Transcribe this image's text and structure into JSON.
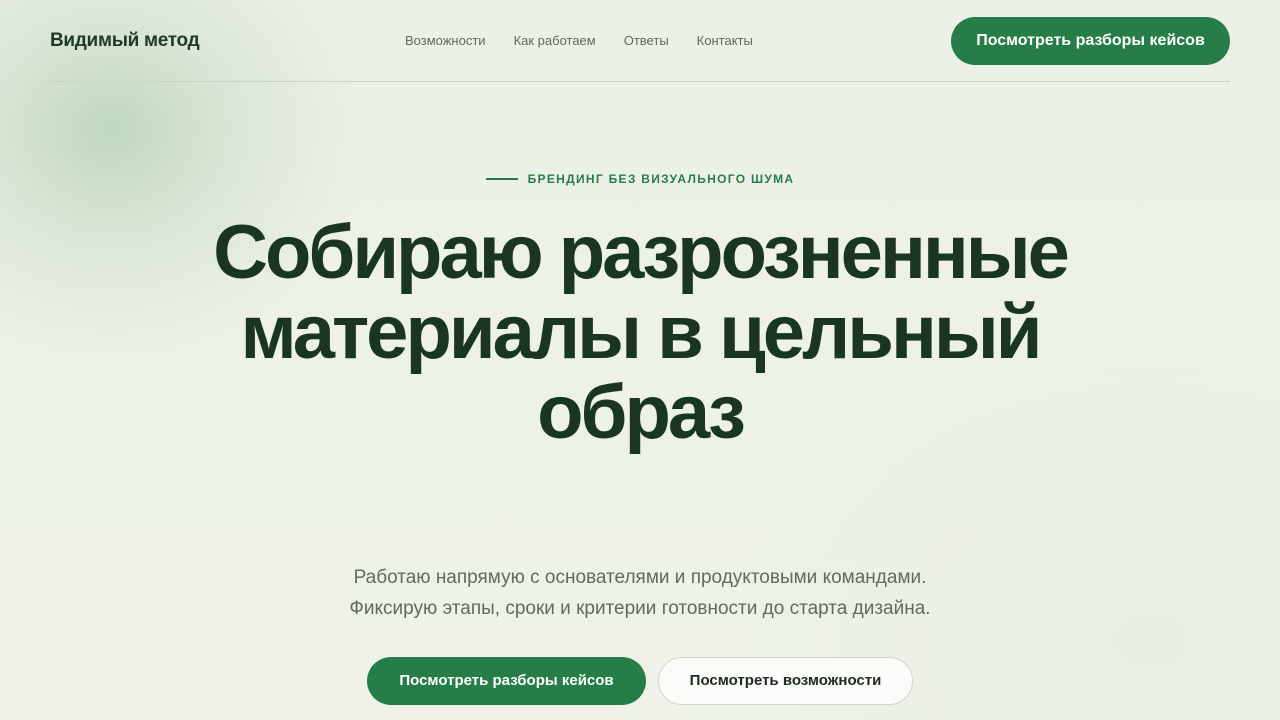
{
  "header": {
    "logo": "Видимый метод",
    "nav": [
      {
        "label": "Возможности"
      },
      {
        "label": "Как работаем"
      },
      {
        "label": "Ответы"
      },
      {
        "label": "Контакты"
      }
    ],
    "cta_label": "Посмотреть разборы кейсов"
  },
  "hero": {
    "eyebrow": "БРЕНДИНГ БЕЗ ВИЗУАЛЬНОГО ШУМА",
    "headline": "Собираю разрозненные материалы в цельный образ",
    "subtitle_lines": [
      "Работаю напрямую с основателями и продуктовыми командами.",
      "Фиксирую этапы, сроки и критерии готовности до старта дизайна."
    ],
    "primary_cta": "Посмотреть разборы кейсов",
    "secondary_cta": "Посмотреть возможности"
  },
  "colors": {
    "accent": "#277d48",
    "heading": "#1a3522",
    "background": "#edf2e8"
  }
}
